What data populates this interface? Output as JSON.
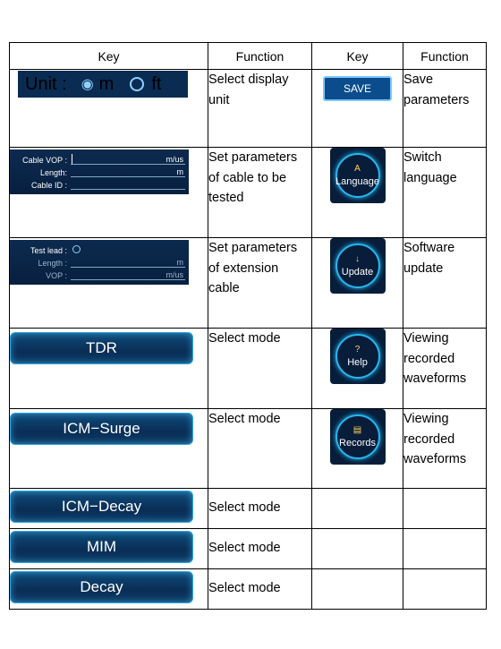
{
  "headers": [
    "Key",
    "Function",
    "Key",
    "Function"
  ],
  "rows": [
    {
      "left_key": {
        "unit_label": "Unit :",
        "opt1": "m",
        "opt2": "ft"
      },
      "left_func": "Select display unit",
      "right_key": {
        "label": "SAVE"
      },
      "right_func": "Save parameters"
    },
    {
      "left_key": {
        "f1_label": "Cable VOP :",
        "f1_unit": "m/us",
        "f2_label": "Length:",
        "f2_unit": "m",
        "f3_label": "Cable ID :",
        "f3_unit": ""
      },
      "left_func": "Set parameters of cable to be tested",
      "right_key": {
        "label": "Language",
        "glyph": "A"
      },
      "right_func": "Switch language"
    },
    {
      "left_key": {
        "f1_label": "Test lead :",
        "f2_label": "Length :",
        "f2_unit": "m",
        "f3_label": "VOP :",
        "f3_unit": "m/us"
      },
      "left_func": "Set parameters of extension cable",
      "right_key": {
        "label": "Update",
        "glyph": "↓"
      },
      "right_func": "Software update"
    },
    {
      "left_key": {
        "label": "TDR"
      },
      "left_func": "Select mode",
      "right_key": {
        "label": "Help",
        "glyph": "?"
      },
      "right_func": "Viewing recorded waveforms"
    },
    {
      "left_key": {
        "label": "ICM−Surge"
      },
      "left_func": "Select mode",
      "right_key": {
        "label": "Records",
        "glyph": "▤"
      },
      "right_func": "Viewing recorded waveforms"
    },
    {
      "left_key": {
        "label": "ICM−Decay"
      },
      "left_func": "Select mode"
    },
    {
      "left_key": {
        "label": "MIM"
      },
      "left_func": "Select mode"
    },
    {
      "left_key": {
        "label": "Decay"
      },
      "left_func": "Select mode"
    }
  ]
}
